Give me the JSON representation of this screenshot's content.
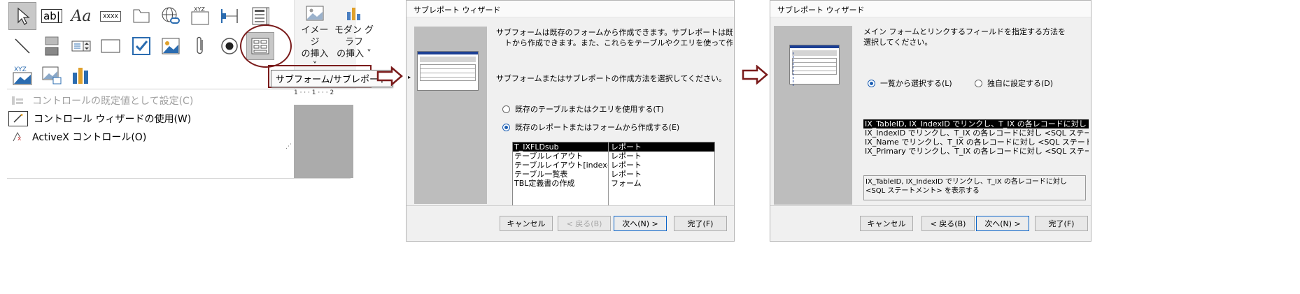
{
  "panel1": {
    "ribbon": {
      "image_insert": [
        "イメージ",
        "の挿入 ˅"
      ],
      "modern_graph": [
        "モダン グラフ",
        "の挿入 ˅"
      ]
    },
    "gallery_icons": [
      "select-arrow-icon",
      "textbox-icon",
      "label-icon",
      "button-icon",
      "tab-control-icon",
      "hyperlink-icon",
      "web-browser-icon",
      "navigation-icon",
      "option-group-icon",
      "insert-page-break-icon",
      "combobox-icon",
      "line-icon",
      "toggle-icon",
      "listbox-icon",
      "rectangle-icon",
      "checkbox-icon",
      "image-icon",
      "attachment-icon",
      "option-button-icon",
      "subform-icon",
      "chart-icon",
      "unbound-object-icon",
      "bound-object-icon",
      "bar-chart-icon"
    ],
    "label_icon_text": "Aa",
    "textbox_icon_text": "ab|",
    "button_icon_text": "XXXX",
    "xyz_text": "XYZ",
    "tooltip": "サブフォーム/サブレポート",
    "menu": [
      {
        "label": "コントロールの既定値として設定(C)",
        "disabled": true
      },
      {
        "label": "コントロール ウィザードの使用(W)",
        "disabled": false
      },
      {
        "label": "ActiveX コントロール(O)",
        "disabled": false
      }
    ],
    "ruler_text": "1 · · · 1 · · · 2"
  },
  "dialog2": {
    "title": "サブレポート ウィザード",
    "description": [
      "サブフォームは既存のフォームから作成できます。サブレポートは既存のフォーム",
      "トから作成できます。また、これらをテーブルやクエリを使って作成することもで"
    ],
    "prompt": "サブフォームまたはサブレポートの作成方法を選択してください。",
    "options": [
      {
        "label": "既存のテーブルまたはクエリを使用する(T)",
        "selected": false
      },
      {
        "label": "既存のレポートまたはフォームから作成する(E)",
        "selected": true
      }
    ],
    "list": [
      {
        "name": "T_IXFLDsub",
        "type": "レポート",
        "selected": true
      },
      {
        "name": "テーブルレイアウト",
        "type": "レポート",
        "selected": false
      },
      {
        "name": "テーブルレイアウト[indexのみ",
        "type": "レポート",
        "selected": false
      },
      {
        "name": "テーブル一覧表",
        "type": "レポート",
        "selected": false
      },
      {
        "name": "TBL定義書の作成",
        "type": "フォーム",
        "selected": false
      }
    ],
    "buttons": {
      "cancel": "キャンセル",
      "back": "< 戻る(B)",
      "next": "次へ(N) >",
      "finish": "完了(F)"
    }
  },
  "dialog3": {
    "title": "サブレポート ウィザード",
    "description": [
      "メイン フォームとリンクするフィールドを指定する方法を",
      "選択してください。"
    ],
    "options": [
      {
        "label": "一覧から選択する(L)",
        "selected": true
      },
      {
        "label": "独自に設定する(D)",
        "selected": false
      }
    ],
    "list": [
      {
        "text": "IX_TableID, IX_IndexID でリンクし、T_IX の各レコードに対し <S",
        "selected": true
      },
      {
        "text": "IX_IndexID でリンクし、T_IX の各レコードに対し <SQL ステートメン",
        "selected": false
      },
      {
        "text": "IX_Name でリンクし、T_IX の各レコードに対し <SQL ステートメン",
        "selected": false
      },
      {
        "text": "IX_Primary でリンクし、T_IX の各レコードに対し <SQL ステートメン",
        "selected": false
      }
    ],
    "detail": [
      "IX_TableID, IX_IndexID でリンクし、T_IX の各レコードに対し",
      "<SQL ステートメント> を表示する"
    ],
    "buttons": {
      "cancel": "キャンセル",
      "back": "< 戻る(B)",
      "next": "次へ(N) >",
      "finish": "完了(F)"
    }
  }
}
